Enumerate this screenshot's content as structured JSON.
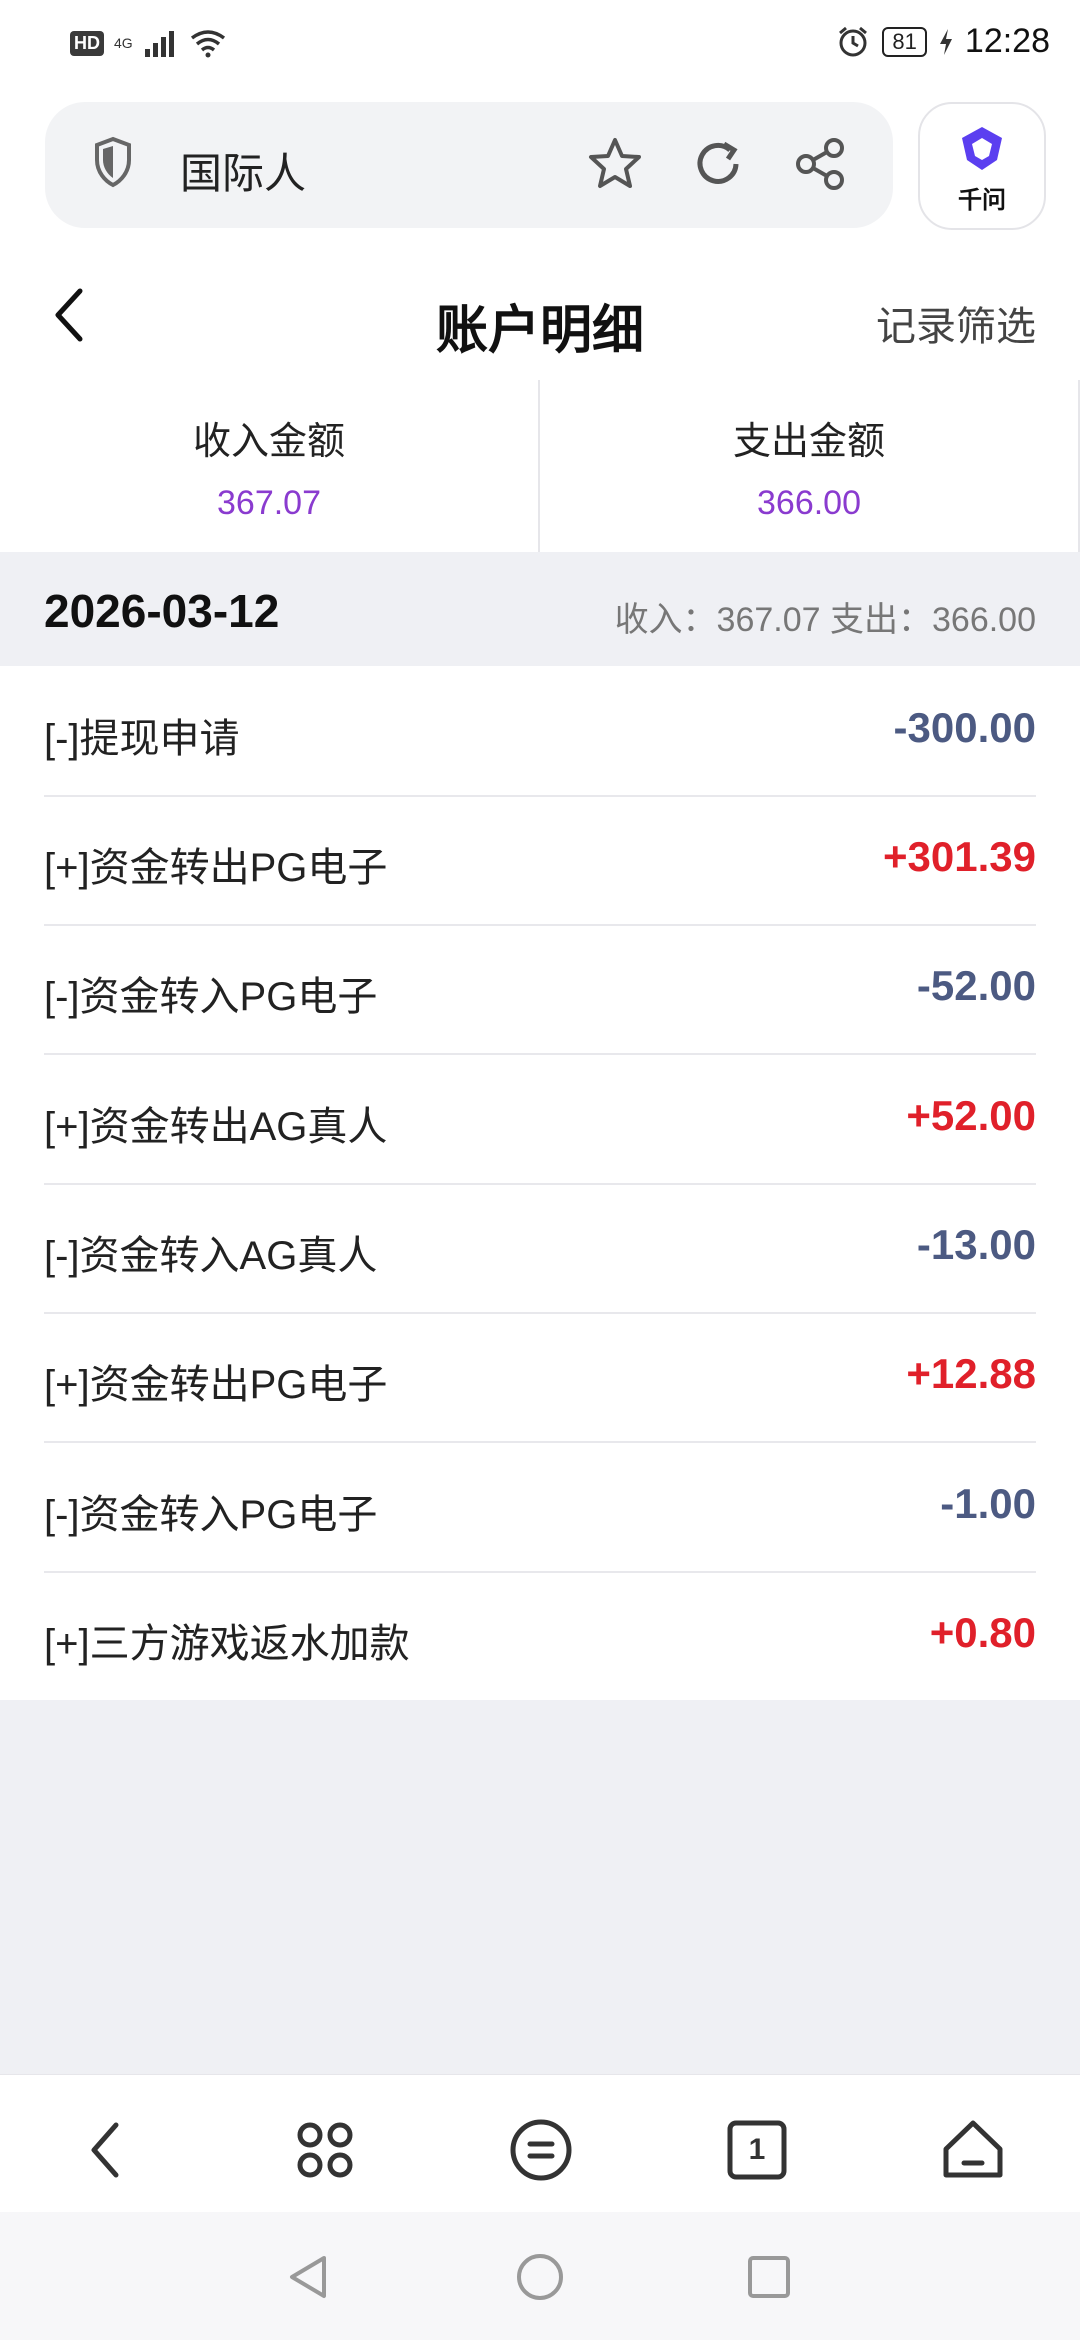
{
  "status_bar": {
    "hd": "HD",
    "network": "4G",
    "battery": "81",
    "time": "12:28"
  },
  "browser": {
    "url_title": "国际人",
    "assistant_label": "千问"
  },
  "header": {
    "title": "账户明细",
    "filter_label": "记录筛选"
  },
  "summary": {
    "income_label": "收入金额",
    "income_value": "367.07",
    "expense_label": "支出金额",
    "expense_value": "366.00"
  },
  "group": {
    "date": "2026-03-12",
    "summary_text": "收入：367.07   支出：366.00"
  },
  "records": [
    {
      "title": "[-]提现申请",
      "amount": "-300.00",
      "sign": "neg"
    },
    {
      "title": "[+]资金转出PG电子",
      "amount": "+301.39",
      "sign": "pos"
    },
    {
      "title": "[-]资金转入PG电子",
      "amount": "-52.00",
      "sign": "neg"
    },
    {
      "title": "[+]资金转出AG真人",
      "amount": "+52.00",
      "sign": "pos"
    },
    {
      "title": "[-]资金转入AG真人",
      "amount": "-13.00",
      "sign": "neg"
    },
    {
      "title": "[+]资金转出PG电子",
      "amount": "+12.88",
      "sign": "pos"
    },
    {
      "title": "[-]资金转入PG电子",
      "amount": "-1.00",
      "sign": "neg"
    },
    {
      "title": "[+]三方游戏返水加款",
      "amount": "+0.80",
      "sign": "pos"
    }
  ],
  "bottom_nav": {
    "tab_count": "1"
  },
  "colors": {
    "income_accent": "#8a3bcf",
    "positive_amount": "#e0202a",
    "negative_amount": "#4c5a82"
  }
}
